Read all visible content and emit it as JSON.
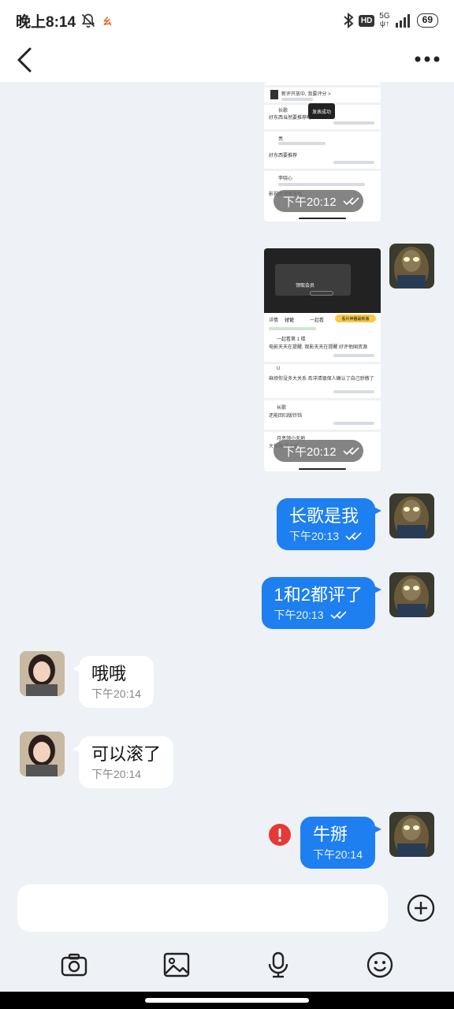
{
  "status_bar": {
    "time": "晚上8:14",
    "app_badge": "ㄠ",
    "hd": "HD",
    "network": "5G",
    "network_sub": "ψ↑",
    "battery": "69"
  },
  "messages": {
    "img1_time": "下午20:12",
    "img2_time": "下午20:12",
    "m1_text": "长歌是我",
    "m1_time": "下午20:13",
    "m2_text": "1和2都评了",
    "m2_time": "下午20:13",
    "m3_text": "哦哦",
    "m3_time": "下午20:14",
    "m4_text": "可以滚了",
    "m4_time": "下午20:14",
    "m5_text": "牛掰",
    "m5_time": "下午20:14"
  },
  "screenshot1": {
    "line1": "新评开放中, 我要评分 >",
    "line2": "长歌",
    "toast": "发表成功",
    "line3": "好东西当然要推荐呀",
    "line4": "亮",
    "line5": "好东西要推荐",
    "line6": "李晓心",
    "line7": "影视资源哪里找..."
  },
  "screenshot2": {
    "dialog": "领取会员",
    "tabs": [
      "详情",
      "讨论",
      "一起看"
    ],
    "cta": "看片神器最新版",
    "c1": "一起看第 1 楼",
    "c1_text": "电影天天在提醒, 观影天天在提醒 好评他国资源",
    "c2": "U",
    "c2_text": "麻烦你没多大关系 否冲清银保人确认了自己骄傲了",
    "c3": "长歌",
    "c3_text": "还能回归版铃铛",
    "c4": "月亮领小天地",
    "c4_text": "大推荐 我之后..."
  },
  "input": {
    "placeholder": ""
  }
}
